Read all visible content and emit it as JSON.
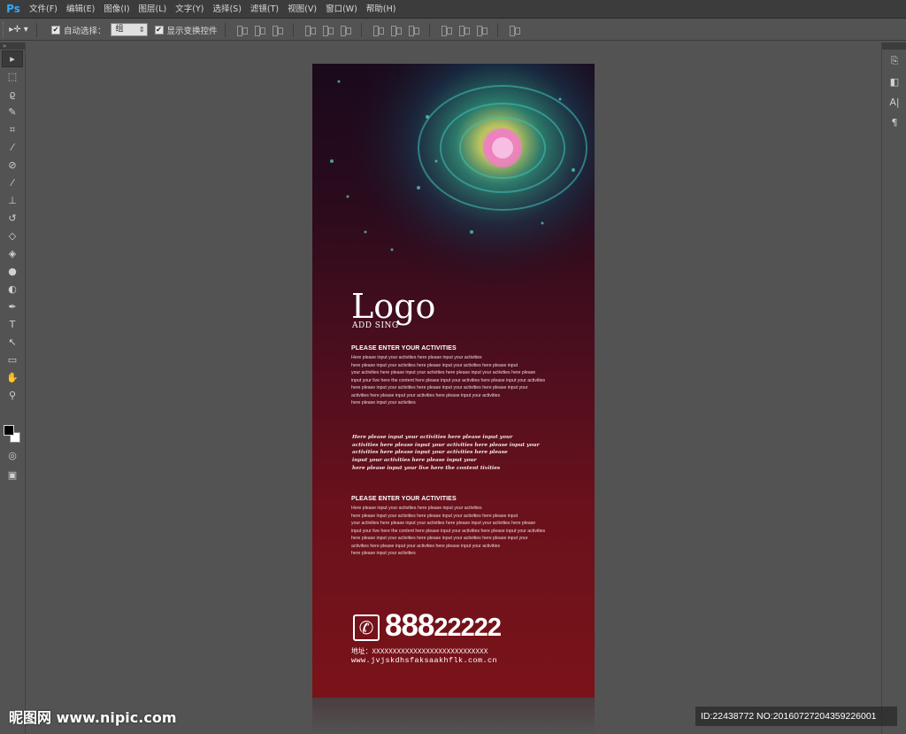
{
  "app": {
    "logo": "Ps"
  },
  "menu": [
    "文件(F)",
    "编辑(E)",
    "图像(I)",
    "图层(L)",
    "文字(Y)",
    "选择(S)",
    "滤镜(T)",
    "视图(V)",
    "窗口(W)",
    "帮助(H)"
  ],
  "options": {
    "tool_icon": "move-tool-icon",
    "auto_select_label": "自动选择：",
    "auto_select_checked": true,
    "auto_select_value": "组",
    "show_transform_label": "显示变换控件",
    "show_transform_checked": true
  },
  "tools": [
    "move-tool-icon",
    "marquee-icon",
    "lasso-icon",
    "quick-select-icon",
    "crop-icon",
    "eyedropper-icon",
    "healing-brush-icon",
    "brush-icon",
    "clone-stamp-icon",
    "history-brush-icon",
    "eraser-icon",
    "paint-bucket-icon",
    "blur-icon",
    "dodge-icon",
    "pen-icon",
    "type-icon",
    "path-select-icon",
    "rectangle-icon",
    "hand-icon",
    "zoom-icon"
  ],
  "right_panel": [
    "history-icon",
    "layers-icon",
    "character-icon",
    "paragraph-icon"
  ],
  "colors": {
    "foreground": "#000000",
    "background": "#ffffff",
    "poster_top": "#1a0a1c",
    "poster_bottom": "#7a1319",
    "accent_teal": "#3fc3b8"
  },
  "poster": {
    "logo": "Logo",
    "logo_sub": "ADD SING",
    "section1_title": "PLEASE ENTER YOUR ACTIVITIES",
    "section1_lines": [
      "Here please input your activities here please input your activities",
      "here please input your activities here please input your activities here please input",
      "your activities here please input your activities here please input your activities here please",
      "input your live here the content here please input your activities here please input your activities",
      "here please input your activities here please input your activities here please input your",
      "activities here please input your activities here please input your activities",
      "here please input your activities"
    ],
    "script_lines": [
      "Here please input your activities here please input your",
      "activities here please input your activities here please input your",
      "activities here please input your activities here please",
      "input your activities here please input your",
      "here please input your live here the content tivities"
    ],
    "section2_title": "PLEASE ENTER YOUR ACTIVITIES",
    "section2_lines": [
      "Here please input your activities here please input your activities",
      "here please input your activities here please input your activities here please input",
      "your activities here please input your activities here please input your activities here please",
      "input your live here the content here please input your activities here please input your activities",
      "here please input your activities here please input your activities here please input your",
      " activities here please input your activities here please input your activities",
      "here please input your activities"
    ],
    "phone_big": "888",
    "phone_small": "22222",
    "address": "地址：XXXXXXXXXXXXXXXXXXXXXXXXXXXX",
    "website": "www.jvjskdhsfaksaakhflk.com.cn"
  },
  "watermark": {
    "site": "昵图网 www.nipic.com",
    "id": "ID:22438772 NO:20160727204359226001"
  }
}
